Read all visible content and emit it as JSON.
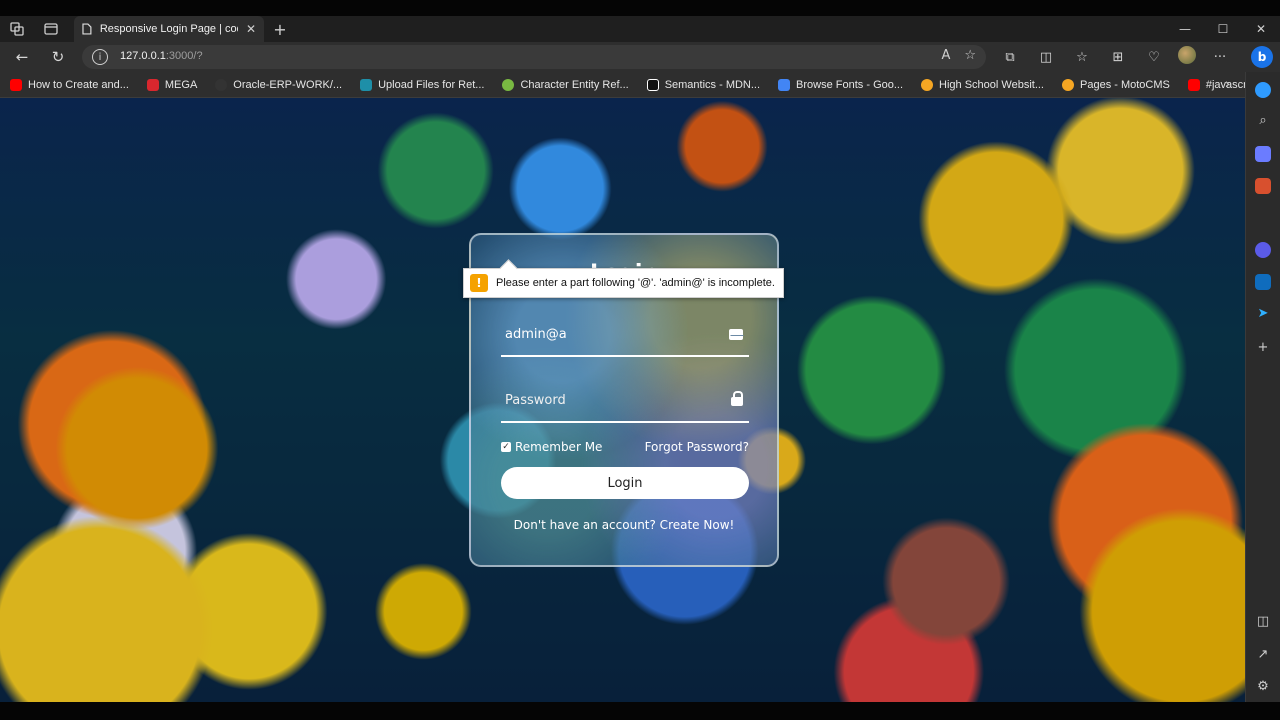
{
  "browser": {
    "tab_title": "Responsive Login Page | codewit",
    "tab_close": "✕",
    "new_tab": "+",
    "window_controls": [
      "—",
      "☐",
      "✕"
    ],
    "url_host": "127.0.0.1",
    "url_rest": ":3000/?",
    "bookmarks": [
      {
        "label": "How to Create and...",
        "color": "#ff0000"
      },
      {
        "label": "MEGA",
        "color": "#d9272e"
      },
      {
        "label": "Oracle-ERP-WORK/...",
        "color": "#333333"
      },
      {
        "label": "Upload Files for Ret...",
        "color": "#1e8fa8"
      },
      {
        "label": "Character Entity Ref...",
        "color": "#79b942"
      },
      {
        "label": "Semantics - MDN...",
        "color": "#111111"
      },
      {
        "label": "Browse Fonts - Goo...",
        "color": "#4285f4"
      },
      {
        "label": "High School Websit...",
        "color": "#f5a623"
      },
      {
        "label": "Pages - MotoCMS",
        "color": "#f5a623"
      },
      {
        "label": "#javascript - YouTube",
        "color": "#ff0000"
      }
    ],
    "bing_label": "b"
  },
  "login": {
    "title": "Login",
    "email_value": "admin@a",
    "email_icon": "envelope-icon",
    "password_placeholder": "Password",
    "password_icon": "lock-icon",
    "remember_label": "Remember Me",
    "remember_checked": true,
    "forgot_label": "Forgot Password?",
    "button_label": "Login",
    "register_text": "Don't have an account? Create Now!"
  },
  "validation": {
    "icon": "!",
    "message": "Please enter a part following '@'. 'admin@' is incomplete."
  },
  "sidebar_icons": [
    "bell-icon",
    "search-icon",
    "tag-icon",
    "toolbox-icon",
    "edge-icon",
    "outlook-icon",
    "send-icon",
    "plus-icon",
    "layout-icon",
    "external-link-icon",
    "settings-icon"
  ]
}
